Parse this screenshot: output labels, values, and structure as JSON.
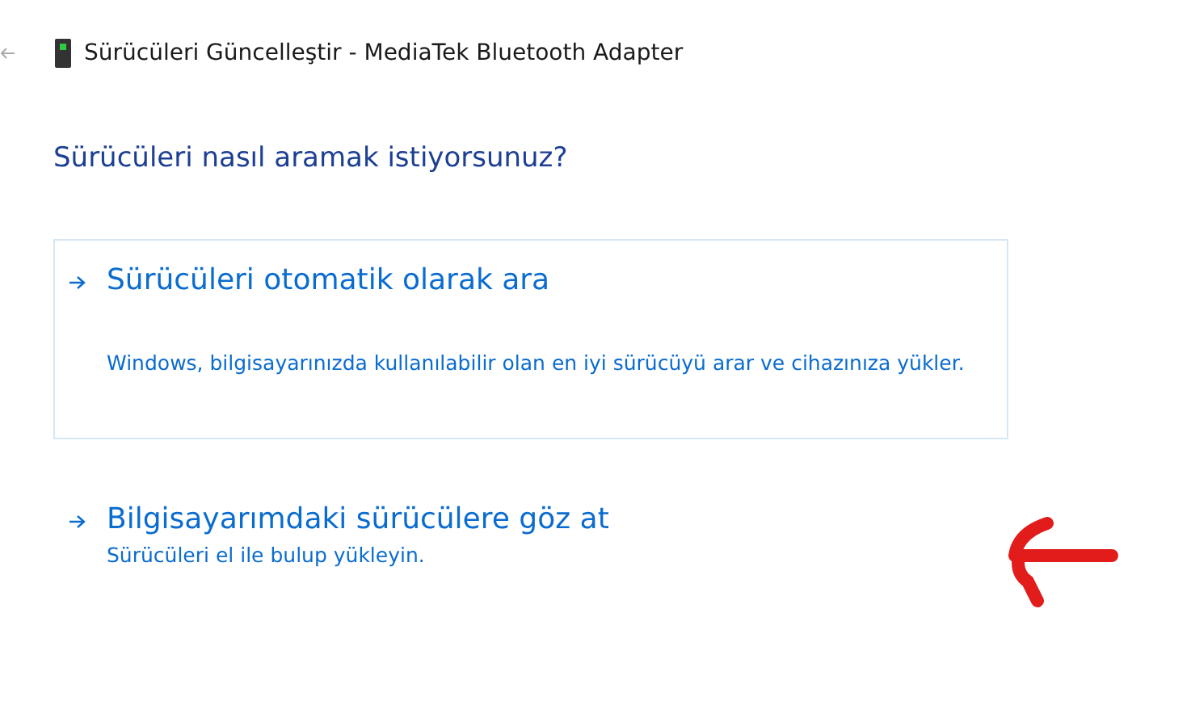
{
  "window": {
    "title": "Sürücüleri Güncelleştir - MediaTek Bluetooth Adapter"
  },
  "heading": "Sürücüleri nasıl aramak istiyorsunuz?",
  "options": [
    {
      "title": "Sürücüleri otomatik olarak ara",
      "description": "Windows, bilgisayarınızda kullanılabilir olan en iyi sürücüyü arar ve cihazınıza yükler.",
      "selected": true
    },
    {
      "title": "Bilgisayarımdaki sürücülere göz at",
      "description": "Sürücüleri el ile bulup yükleyin.",
      "selected": false
    }
  ]
}
